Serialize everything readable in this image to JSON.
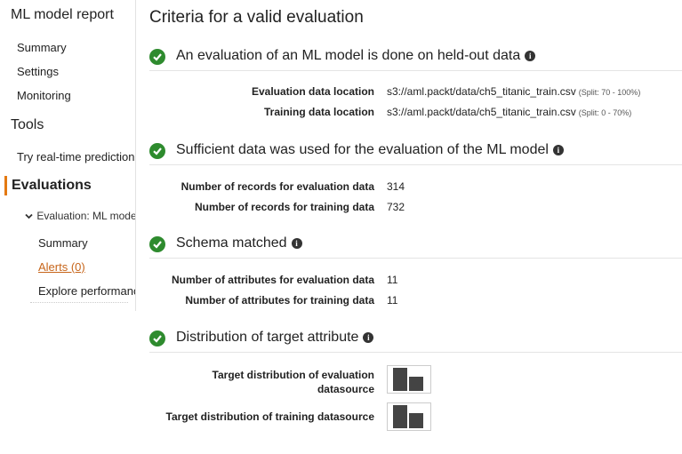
{
  "sidebar": {
    "title": "ML model report",
    "items": [
      "Summary",
      "Settings",
      "Monitoring"
    ],
    "tools_heading": "Tools",
    "tools_item": "Try real-time predictions",
    "evaluations_heading": "Evaluations",
    "evaluation_node": "Evaluation: ML model",
    "sub_items": [
      "Summary",
      "Alerts (0)",
      "Explore performance"
    ]
  },
  "main": {
    "title": "Criteria for a valid evaluation",
    "sections": [
      {
        "title": "An evaluation of an ML model is done on held-out data",
        "rows": [
          {
            "label": "Evaluation data location",
            "value": "s3://aml.packt/data/ch5_titanic_train.csv",
            "note": "(Split: 70 - 100%)"
          },
          {
            "label": "Training data location",
            "value": "s3://aml.packt/data/ch5_titanic_train.csv",
            "note": "(Split: 0 - 70%)"
          }
        ]
      },
      {
        "title": "Sufficient data was used for the evaluation of the ML model",
        "rows": [
          {
            "label": "Number of records for evaluation data",
            "value": "314"
          },
          {
            "label": "Number of records for training data",
            "value": "732"
          }
        ]
      },
      {
        "title": "Schema matched",
        "rows": [
          {
            "label": "Number of attributes for evaluation data",
            "value": "11"
          },
          {
            "label": "Number of attributes for training data",
            "value": "11"
          }
        ]
      },
      {
        "title": "Distribution of target attribute",
        "rows": [
          {
            "label": "Target distribution of evaluation datasource",
            "bars": [
              0.62,
              0.38
            ]
          },
          {
            "label": "Target distribution of training datasource",
            "bars": [
              0.61,
              0.39
            ]
          }
        ]
      }
    ]
  },
  "colors": {
    "check": "#2e8b2e",
    "accent": "#e47911",
    "link": "#c7651a"
  },
  "icons": {
    "check": "check-circle-icon",
    "info": "info-icon",
    "chevron": "chevron-down-icon"
  }
}
